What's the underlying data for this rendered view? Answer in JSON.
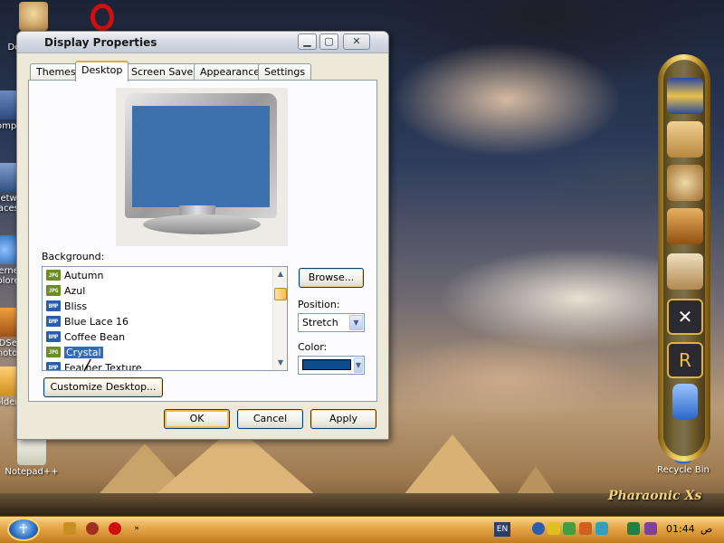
{
  "desktop": {
    "icons": [
      {
        "label": "My Documents",
        "icon": "scribe-statue-icon"
      },
      {
        "label": "My Computer",
        "icon": "computer-icon"
      },
      {
        "label": "My Network Places",
        "icon": "network-icon"
      },
      {
        "label": "Internet Explorer",
        "icon": "browser-icon"
      },
      {
        "label": "ACDSee Photo",
        "icon": "photo-app-icon"
      },
      {
        "label": "Folder",
        "icon": "folder-icon"
      },
      {
        "label": "Notepad++",
        "icon": "notepad-icon"
      },
      {
        "label": "Recycle Bin",
        "icon": "recycle-bin-icon"
      }
    ],
    "brand": "Pharaonic Xs"
  },
  "window": {
    "title": "Display Properties",
    "tabs": [
      {
        "label": "Themes",
        "active": false
      },
      {
        "label": "Desktop",
        "active": true
      },
      {
        "label": "Screen Saver",
        "active": false
      },
      {
        "label": "Appearance",
        "active": false
      },
      {
        "label": "Settings",
        "active": false
      }
    ],
    "background_label": "Background:",
    "backgrounds": [
      {
        "name": "Autumn",
        "type": "JPG",
        "selected": false
      },
      {
        "name": "Azul",
        "type": "JPG",
        "selected": false
      },
      {
        "name": "Bliss",
        "type": "BMP",
        "selected": false
      },
      {
        "name": "Blue Lace 16",
        "type": "BMP",
        "selected": false
      },
      {
        "name": "Coffee Bean",
        "type": "BMP",
        "selected": false
      },
      {
        "name": "Crystal",
        "type": "JPG",
        "selected": true
      },
      {
        "name": "Feather Texture",
        "type": "BMP",
        "selected": false
      }
    ],
    "browse_label": "Browse...",
    "position_label": "Position:",
    "position_value": "Stretch",
    "color_label": "Color:",
    "color_value": "#0a4c8c",
    "customize_label": "Customize Desktop...",
    "ok_label": "OK",
    "cancel_label": "Cancel",
    "apply_label": "Apply",
    "preview_color": "#3d71ae"
  },
  "taskbar": {
    "language": "EN",
    "time": "01:44",
    "ampm": "ص"
  }
}
